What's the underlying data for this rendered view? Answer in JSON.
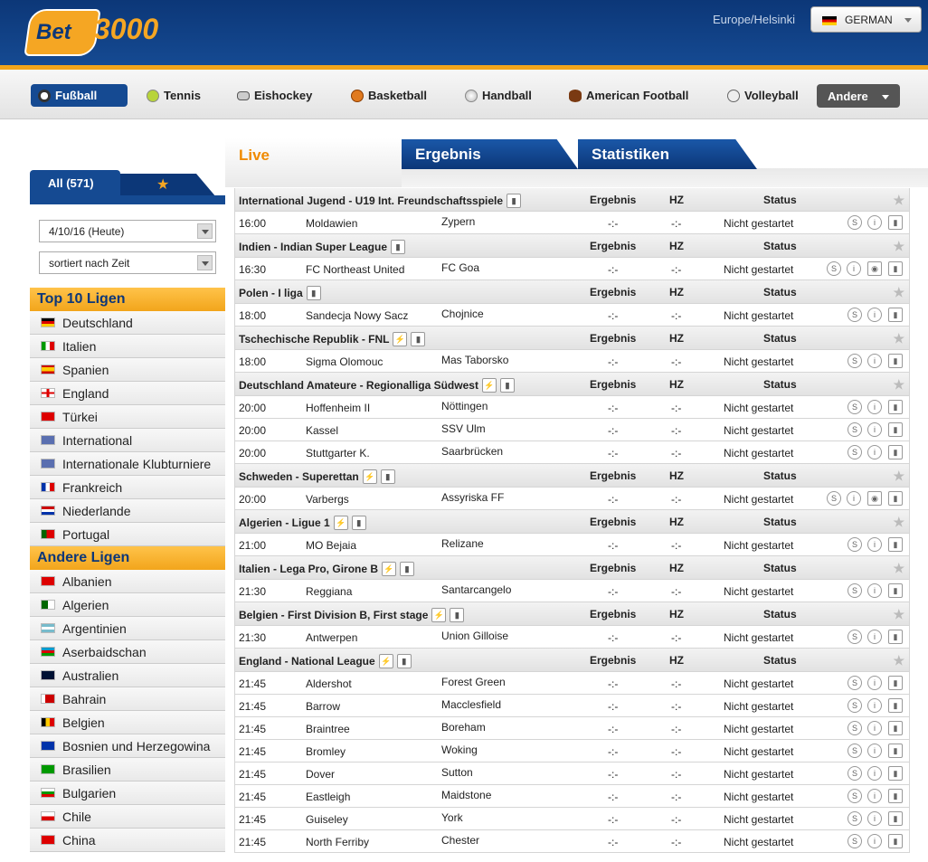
{
  "header": {
    "logo_bet": "Bet",
    "logo_num": "3000",
    "timezone": "Europe/Helsinki",
    "language": "GERMAN",
    "colors": {
      "primary": "#154a92",
      "accent": "#f2a51b"
    }
  },
  "sports": [
    {
      "label": "Fußball",
      "icon": "soccer-ball-icon",
      "active": true
    },
    {
      "label": "Tennis",
      "icon": "tennis-ball-icon"
    },
    {
      "label": "Eishockey",
      "icon": "hockey-puck-icon"
    },
    {
      "label": "Basketball",
      "icon": "basketball-icon"
    },
    {
      "label": "Handball",
      "icon": "handball-icon"
    },
    {
      "label": "American Football",
      "icon": "american-football-icon"
    },
    {
      "label": "Volleyball",
      "icon": "volleyball-icon"
    },
    {
      "label": "Andere",
      "icon": "chevron-down-icon"
    }
  ],
  "sidebar": {
    "tab_all": "All (571)",
    "date_select": "4/10/16 (Heute)",
    "sort_select": "sortiert nach Zeit",
    "top_heading": "Top 10 Ligen",
    "top_items": [
      "Deutschland",
      "Italien",
      "Spanien",
      "England",
      "Türkei",
      "International",
      "Internationale Klubturniere",
      "Frankreich",
      "Niederlande",
      "Portugal"
    ],
    "other_heading": "Andere Ligen",
    "other_items": [
      "Albanien",
      "Algerien",
      "Argentinien",
      "Aserbaidschan",
      "Australien",
      "Bahrain",
      "Belgien",
      "Bosnien und Herzegowina",
      "Brasilien",
      "Bulgarien",
      "Chile",
      "China"
    ]
  },
  "tabs": {
    "live": "Live",
    "ergebnis": "Ergebnis",
    "statistiken": "Statistiken"
  },
  "columns": {
    "ergebnis": "Ergebnis",
    "hz": "HZ",
    "status": "Status"
  },
  "icons": {
    "s": "S",
    "i": "i",
    "stats": "▮"
  },
  "leagues": [
    {
      "name": "International Jugend - U19 Int. Freundschaftsspiele",
      "live": false,
      "matches": [
        {
          "time": "16:00",
          "home": "Moldawien",
          "away": "Zypern",
          "erg": "-:-",
          "hz": "-:-",
          "status": "Nicht gestartet"
        }
      ]
    },
    {
      "name": "Indien - Indian Super League",
      "live": false,
      "matches": [
        {
          "time": "16:30",
          "home": "FC Northeast United",
          "away": "FC Goa",
          "erg": "-:-",
          "hz": "-:-",
          "status": "Nicht gestartet",
          "pin": true
        }
      ]
    },
    {
      "name": "Polen - I liga",
      "live": false,
      "matches": [
        {
          "time": "18:00",
          "home": "Sandecja Nowy Sacz",
          "away": "Chojnice",
          "erg": "-:-",
          "hz": "-:-",
          "status": "Nicht gestartet"
        }
      ]
    },
    {
      "name": "Tschechische Republik - FNL",
      "live": true,
      "matches": [
        {
          "time": "18:00",
          "home": "Sigma Olomouc",
          "away": "Mas Taborsko",
          "erg": "-:-",
          "hz": "-:-",
          "status": "Nicht gestartet"
        }
      ]
    },
    {
      "name": "Deutschland Amateure - Regionalliga Südwest",
      "live": true,
      "matches": [
        {
          "time": "20:00",
          "home": "Hoffenheim II",
          "away": "Nöttingen",
          "erg": "-:-",
          "hz": "-:-",
          "status": "Nicht gestartet"
        },
        {
          "time": "20:00",
          "home": "Kassel",
          "away": "SSV Ulm",
          "erg": "-:-",
          "hz": "-:-",
          "status": "Nicht gestartet"
        },
        {
          "time": "20:00",
          "home": "Stuttgarter K.",
          "away": "Saarbrücken",
          "erg": "-:-",
          "hz": "-:-",
          "status": "Nicht gestartet"
        }
      ]
    },
    {
      "name": "Schweden - Superettan",
      "live": true,
      "matches": [
        {
          "time": "20:00",
          "home": "Varbergs",
          "away": "Assyriska FF",
          "erg": "-:-",
          "hz": "-:-",
          "status": "Nicht gestartet",
          "pin": true
        }
      ]
    },
    {
      "name": "Algerien - Ligue 1",
      "live": true,
      "matches": [
        {
          "time": "21:00",
          "home": "MO Bejaia",
          "away": "Relizane",
          "erg": "-:-",
          "hz": "-:-",
          "status": "Nicht gestartet"
        }
      ]
    },
    {
      "name": "Italien - Lega Pro, Girone B",
      "live": true,
      "matches": [
        {
          "time": "21:30",
          "home": "Reggiana",
          "away": "Santarcangelo",
          "erg": "-:-",
          "hz": "-:-",
          "status": "Nicht gestartet"
        }
      ]
    },
    {
      "name": "Belgien - First Division B, First stage",
      "live": true,
      "matches": [
        {
          "time": "21:30",
          "home": "Antwerpen",
          "away": "Union Gilloise",
          "erg": "-:-",
          "hz": "-:-",
          "status": "Nicht gestartet"
        }
      ]
    },
    {
      "name": "England - National League",
      "live": true,
      "matches": [
        {
          "time": "21:45",
          "home": "Aldershot",
          "away": "Forest Green",
          "erg": "-:-",
          "hz": "-:-",
          "status": "Nicht gestartet"
        },
        {
          "time": "21:45",
          "home": "Barrow",
          "away": "Macclesfield",
          "erg": "-:-",
          "hz": "-:-",
          "status": "Nicht gestartet"
        },
        {
          "time": "21:45",
          "home": "Braintree",
          "away": "Boreham",
          "erg": "-:-",
          "hz": "-:-",
          "status": "Nicht gestartet"
        },
        {
          "time": "21:45",
          "home": "Bromley",
          "away": "Woking",
          "erg": "-:-",
          "hz": "-:-",
          "status": "Nicht gestartet"
        },
        {
          "time": "21:45",
          "home": "Dover",
          "away": "Sutton",
          "erg": "-:-",
          "hz": "-:-",
          "status": "Nicht gestartet"
        },
        {
          "time": "21:45",
          "home": "Eastleigh",
          "away": "Maidstone",
          "erg": "-:-",
          "hz": "-:-",
          "status": "Nicht gestartet"
        },
        {
          "time": "21:45",
          "home": "Guiseley",
          "away": "York",
          "erg": "-:-",
          "hz": "-:-",
          "status": "Nicht gestartet"
        },
        {
          "time": "21:45",
          "home": "North Ferriby",
          "away": "Chester",
          "erg": "-:-",
          "hz": "-:-",
          "status": "Nicht gestartet"
        }
      ]
    }
  ]
}
